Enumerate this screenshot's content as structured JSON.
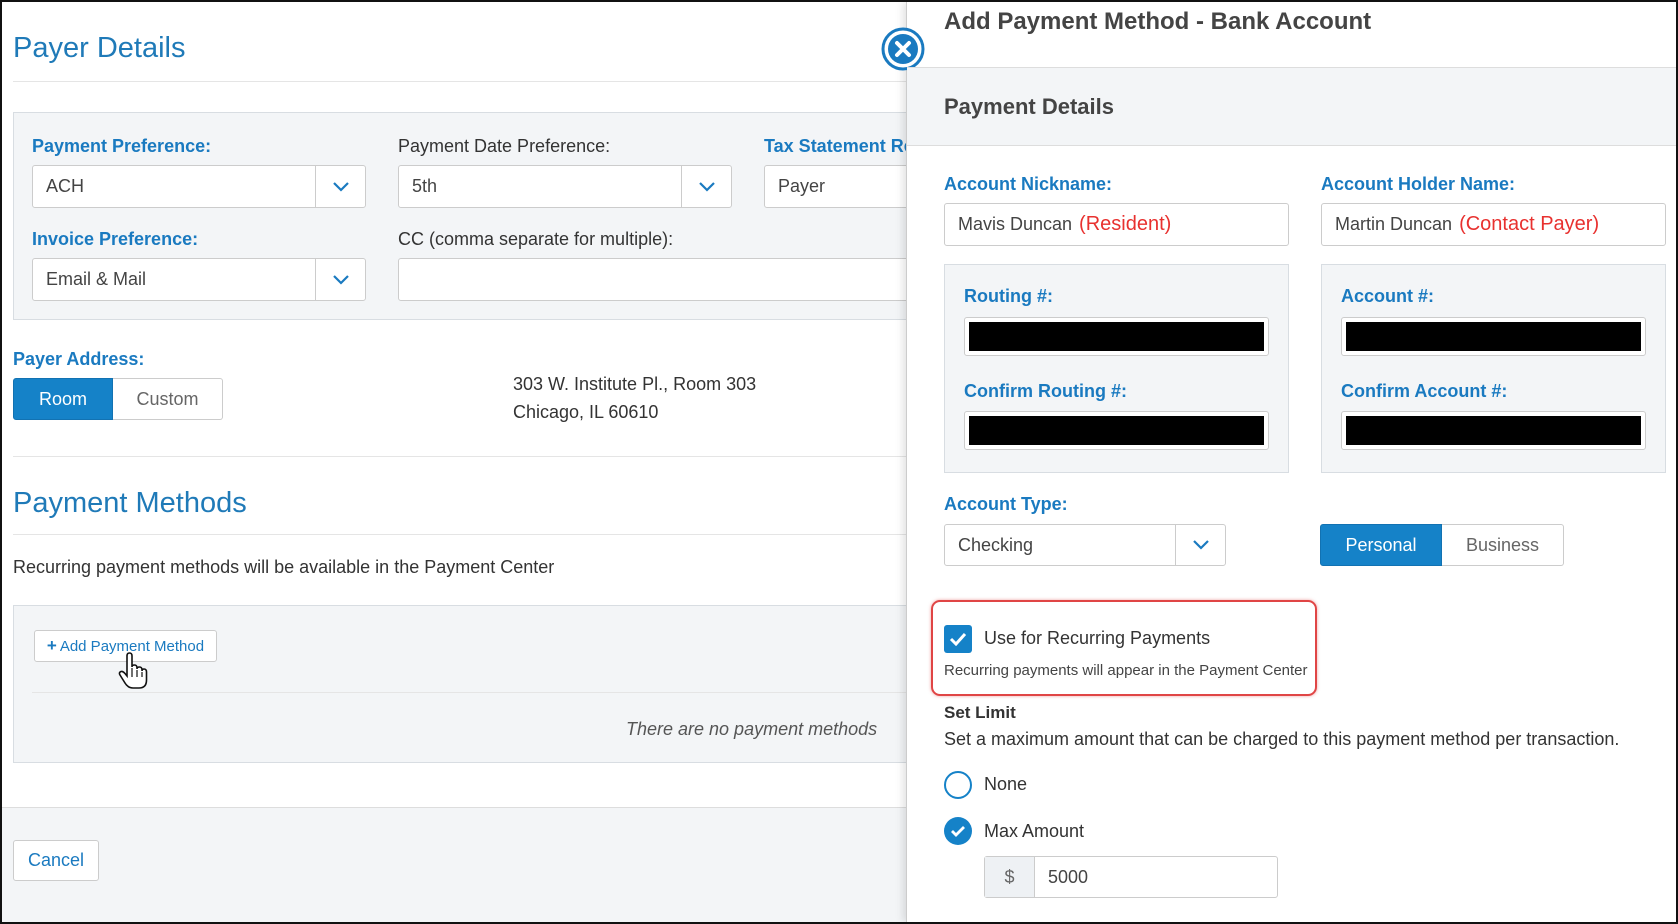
{
  "left": {
    "title": "Payer Details",
    "payment_preference": {
      "label": "Payment Preference:",
      "value": "ACH"
    },
    "payment_date_preference": {
      "label": "Payment Date Preference:",
      "value": "5th"
    },
    "tax_statement": {
      "label": "Tax Statement Re",
      "value": "Payer"
    },
    "invoice_preference": {
      "label": "Invoice Preference:",
      "value": "Email & Mail"
    },
    "cc": {
      "label": "CC (comma separate for multiple):",
      "value": ""
    },
    "payer_address": {
      "label": "Payer Address:",
      "room": "Room",
      "custom": "Custom",
      "line1": "303 W. Institute Pl., Room 303",
      "line2": "Chicago, IL 60610"
    },
    "payment_methods": {
      "title": "Payment Methods",
      "description": "Recurring payment methods will be available in the Payment Center",
      "add_button": "Add Payment Method",
      "empty": "There are no payment methods"
    },
    "cancel": "Cancel"
  },
  "modal": {
    "title": "Add Payment Method - Bank Account",
    "section": "Payment Details",
    "nickname": {
      "label": "Account Nickname:",
      "value": "Mavis Duncan",
      "note": "(Resident)"
    },
    "holder": {
      "label": "Account Holder Name:",
      "value": "Martin Duncan",
      "note": "(Contact Payer)"
    },
    "routing": {
      "label": "Routing #:",
      "confirm": "Confirm Routing #:"
    },
    "account": {
      "label": "Account #:",
      "confirm": "Confirm Account #:"
    },
    "account_type": {
      "label": "Account Type:",
      "value": "Checking"
    },
    "ownership": {
      "personal": "Personal",
      "business": "Business",
      "selected": "Personal"
    },
    "recurring": {
      "label": "Use for Recurring Payments",
      "checked": true,
      "help": "Recurring payments will appear in the Payment Center"
    },
    "limit": {
      "title": "Set Limit",
      "description": "Set a maximum amount that can be charged to this payment method per transaction.",
      "none": "None",
      "max": "Max Amount",
      "selected": "Max Amount",
      "currency": "$",
      "amount": "5000"
    }
  },
  "colors": {
    "accent": "#1a7ac0",
    "highlight": "#e04545"
  }
}
